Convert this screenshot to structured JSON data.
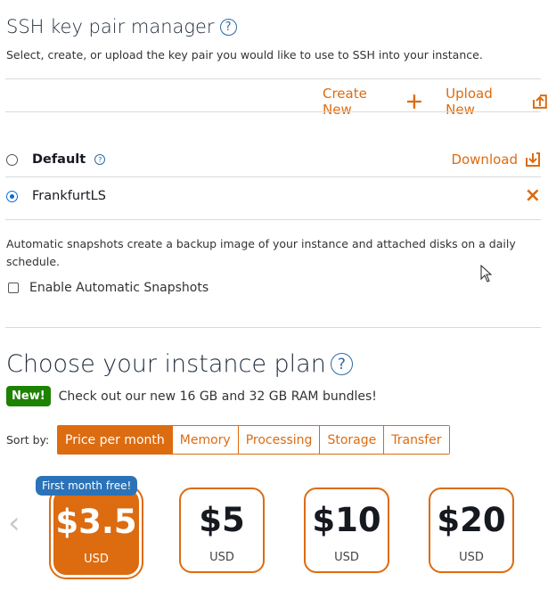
{
  "ssh": {
    "title": "SSH key pair manager",
    "help": "?",
    "description": "Select, create, or upload the key pair you would like to use to SSH into your instance.",
    "create_new": "Create New",
    "upload_new": "Upload New",
    "keys": [
      {
        "label": "Default",
        "help": "?",
        "action": "Download",
        "selected": false
      },
      {
        "label": "FrankfurtLS",
        "action": "×",
        "selected": true
      }
    ]
  },
  "snapshots": {
    "description": "Automatic snapshots create a backup image of your instance and attached disks on a daily schedule.",
    "checkbox_label": "Enable Automatic Snapshots"
  },
  "plan": {
    "title": "Choose your instance plan",
    "help": "?",
    "new_badge": "New!",
    "announcement": "Check out our new 16 GB and 32 GB RAM bundles!",
    "sort_label": "Sort by:",
    "sort_options": [
      "Price per month",
      "Memory",
      "Processing",
      "Storage",
      "Transfer"
    ],
    "free_badge": "First month free!",
    "prev_arrow": "‹",
    "cards": [
      {
        "price": "$3.5",
        "currency": "USD",
        "selected": true
      },
      {
        "price": "$5",
        "currency": "USD",
        "selected": false
      },
      {
        "price": "$10",
        "currency": "USD",
        "selected": false
      },
      {
        "price": "$20",
        "currency": "USD",
        "selected": false
      }
    ]
  },
  "colors": {
    "accent": "#dd6b10",
    "link_blue": "#2b6ca3",
    "new_green": "#1d8102",
    "badge_blue": "#2b73b8"
  }
}
